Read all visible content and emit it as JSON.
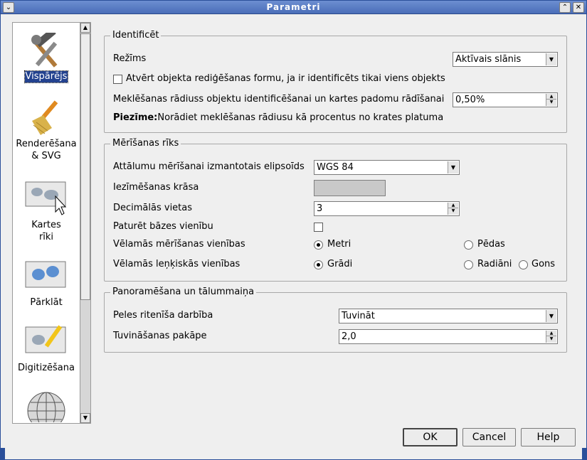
{
  "window": {
    "title": "Parametri",
    "menu_icon": "chevron-down-icon",
    "maximize_icon": "maximize-icon",
    "close_icon": "close-icon"
  },
  "sidebar": {
    "items": [
      {
        "label": "Vispārējs",
        "icon": "tools-icon",
        "selected": true
      },
      {
        "label_line1": "Renderēšana",
        "label_line2": "& SVG",
        "icon": "brush-icon"
      },
      {
        "label_line1": "Kartes",
        "label_line2": "rīki",
        "icon": "map-tools-icon"
      },
      {
        "label": "Pārklāt",
        "icon": "overlay-map-icon"
      },
      {
        "label": "Digitizēšana",
        "icon": "digitize-icon"
      },
      {
        "icon": "globe-icon"
      }
    ]
  },
  "identify": {
    "title": "Identificēt",
    "mode_label": "Režīms",
    "mode_value": "Aktīvais slānis",
    "open_form_label": "Atvērt objekta rediģēšanas formu, ja ir identificēts tikai viens objekts",
    "open_form_checked": false,
    "radius_label": "Meklēšanas rādiuss objektu identificēšanai un kartes padomu rādīšanai",
    "radius_value": "0,50%",
    "note_bold": "Piezīme:",
    "note_text": "Norādiet meklēšanas rādiusu kā procentus no krates platuma"
  },
  "measure": {
    "title": "Mērīšanas rīks",
    "ellipsoid_label": "Attālumu mērīšanai izmantotais elipsoīds",
    "ellipsoid_value": "WGS 84",
    "color_label": "Iezīmēšanas krāsa",
    "color_value": "#c9c9c9",
    "decimals_label": "Decimālās vietas",
    "decimals_value": "3",
    "keep_base_label": "Paturēt bāzes vienību",
    "keep_base_checked": false,
    "units_label": "Vēlamās mērīšanas vienības",
    "units_options": [
      {
        "label": "Metri",
        "selected": true
      },
      {
        "label": "Pēdas",
        "selected": false
      }
    ],
    "angle_label": "Vēlamās leņķiskās vienības",
    "angle_options": [
      {
        "label": "Grādi",
        "selected": true
      },
      {
        "label": "Radiāni",
        "selected": false
      },
      {
        "label": "Gons",
        "selected": false
      }
    ]
  },
  "zoom": {
    "title": "Panoramēšana un tālummaiņa",
    "wheel_label": "Peles ritenīša darbība",
    "wheel_value": "Tuvināt",
    "factor_label": "Tuvināšanas pakāpe",
    "factor_value": "2,0"
  },
  "buttons": {
    "ok": "OK",
    "cancel": "Cancel",
    "help": "Help"
  }
}
